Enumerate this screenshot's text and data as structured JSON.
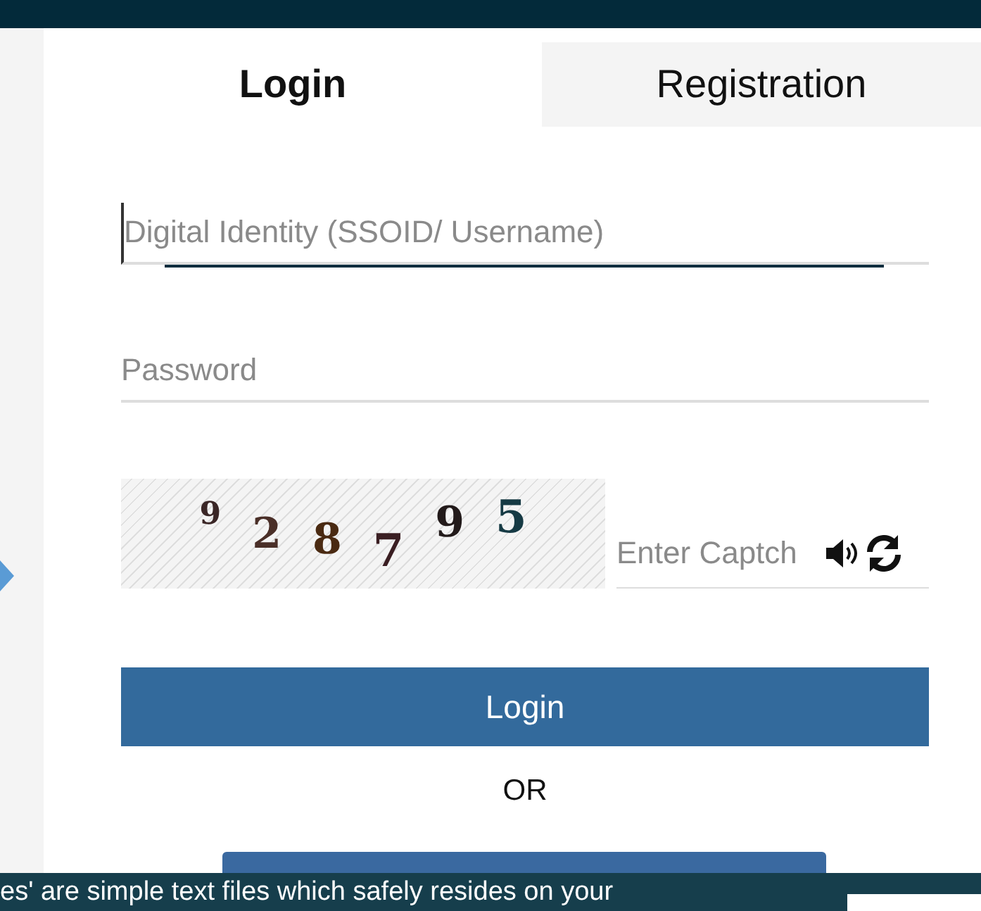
{
  "tabs": [
    {
      "label": "Login",
      "selected": true
    },
    {
      "label": "Registration",
      "selected": false
    }
  ],
  "username": {
    "placeholder": "Digital Identity (SSOID/ Username)",
    "focused": true
  },
  "password": {
    "placeholder": "Password"
  },
  "captcha": {
    "characters": [
      "9",
      "2",
      "8",
      "7",
      "9",
      "5"
    ],
    "placeholder": "Enter Captch"
  },
  "login_button": "Login",
  "separator": "OR",
  "cookie_notice": "es' are simple text files which safely resides on your"
}
